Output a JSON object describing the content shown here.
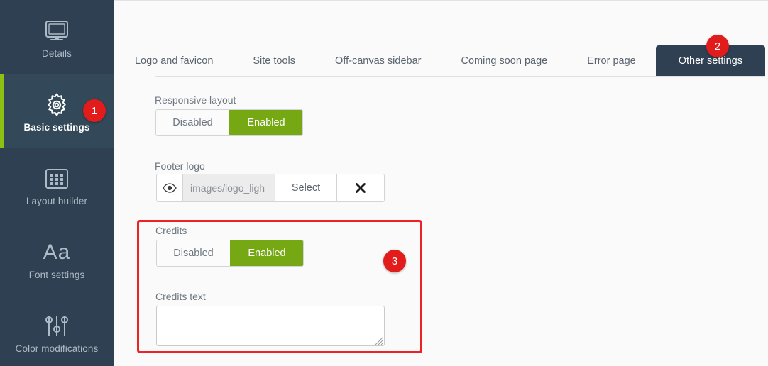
{
  "sidebar": {
    "items": [
      {
        "label": "Details",
        "icon": "monitor-icon",
        "active": false
      },
      {
        "label": "Basic settings",
        "icon": "gear-icon",
        "active": true
      },
      {
        "label": "Layout builder",
        "icon": "grid-icon",
        "active": false
      },
      {
        "label": "Font settings",
        "icon": "typography-icon",
        "glyph": "Aa",
        "active": false
      },
      {
        "label": "Color modifications",
        "icon": "sliders-icon",
        "active": false
      }
    ]
  },
  "tabs": [
    {
      "label": "Logo and favicon",
      "active": false
    },
    {
      "label": "Site tools",
      "active": false
    },
    {
      "label": "Off-canvas sidebar",
      "active": false
    },
    {
      "label": "Coming soon page",
      "active": false
    },
    {
      "label": "Error page",
      "active": false
    },
    {
      "label": "Other settings",
      "active": true
    }
  ],
  "form": {
    "responsive_layout": {
      "label": "Responsive layout",
      "option_off": "Disabled",
      "option_on": "Enabled",
      "value": "Enabled"
    },
    "footer_logo": {
      "label": "Footer logo",
      "path_value": "images/logo_ligh",
      "select_label": "Select",
      "preview_icon": "eye-icon",
      "clear_icon": "close-x-icon"
    },
    "credits": {
      "label": "Credits",
      "option_off": "Disabled",
      "option_on": "Enabled",
      "value": "Enabled"
    },
    "credits_text": {
      "label": "Credits text",
      "value": "",
      "placeholder": ""
    }
  },
  "annotations": {
    "badges": [
      {
        "number": "1",
        "target": "sidebar-item-basic-settings"
      },
      {
        "number": "2",
        "target": "tab-other-settings"
      },
      {
        "number": "3",
        "target": "credits-section"
      }
    ],
    "highlight": {
      "color": "#ee2222",
      "target": "credits-section"
    }
  },
  "colors": {
    "sidebar_bg": "#2e4052",
    "sidebar_active_bg": "#334859",
    "accent_green": "#8cc113",
    "toggle_green": "#76a814",
    "badge_red": "#e21b1b",
    "highlight_red": "#ee2222",
    "content_bg": "#fafafa"
  }
}
